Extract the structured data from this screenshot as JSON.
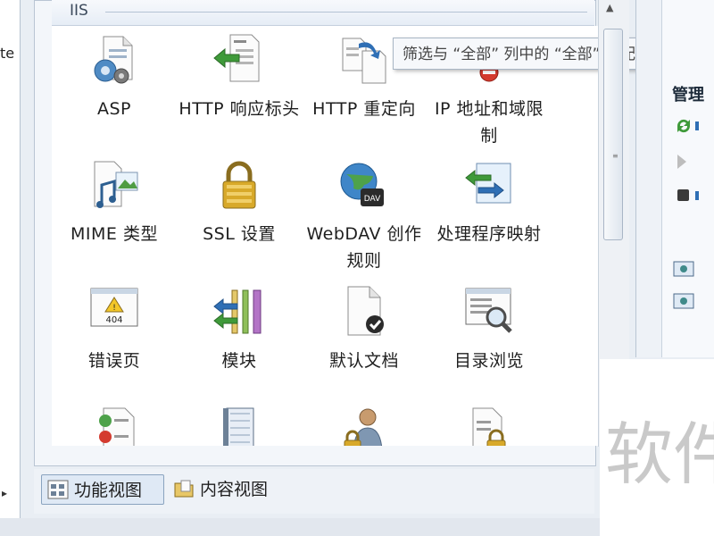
{
  "left_pane": {
    "text_fragment": "te",
    "scroll_arrow": "▸"
  },
  "group": {
    "title": "IIS"
  },
  "tooltip": {
    "text": "筛选与 “全部” 列中的 “全部” 匹配"
  },
  "features": [
    {
      "label": "ASP",
      "icon": "asp-icon"
    },
    {
      "label": "HTTP 响应标头",
      "icon": "http-response-headers-icon"
    },
    {
      "label": "HTTP 重定向",
      "icon": "http-redirect-icon"
    },
    {
      "label": "IP 地址和域限制",
      "icon": "ip-domain-restrictions-icon"
    },
    {
      "label": "MIME 类型",
      "icon": "mime-types-icon"
    },
    {
      "label": "SSL 设置",
      "icon": "ssl-settings-icon"
    },
    {
      "label": "WebDAV 创作规则",
      "icon": "webdav-authoring-rules-icon"
    },
    {
      "label": "处理程序映射",
      "icon": "handler-mappings-icon"
    },
    {
      "label": "错误页",
      "icon": "error-pages-icon"
    },
    {
      "label": "模块",
      "icon": "modules-icon"
    },
    {
      "label": "默认文档",
      "icon": "default-document-icon"
    },
    {
      "label": "目录浏览",
      "icon": "directory-browsing-icon"
    },
    {
      "label": "",
      "icon": "checklist-icon"
    },
    {
      "label": "",
      "icon": "notebook-icon"
    },
    {
      "label": "",
      "icon": "user-lock-icon"
    },
    {
      "label": "",
      "icon": "document-lock-icon"
    }
  ],
  "actions": {
    "heading": "管理"
  },
  "views": {
    "features_view": "功能视图",
    "content_view": "内容视图"
  },
  "watermark": {
    "text": "软件"
  },
  "colors": {
    "accent_blue": "#2f6fb5",
    "green_arrow": "#3f9a3a",
    "stop_dark": "#3a3a3a",
    "watermark_gray": "#c9c9c9"
  }
}
